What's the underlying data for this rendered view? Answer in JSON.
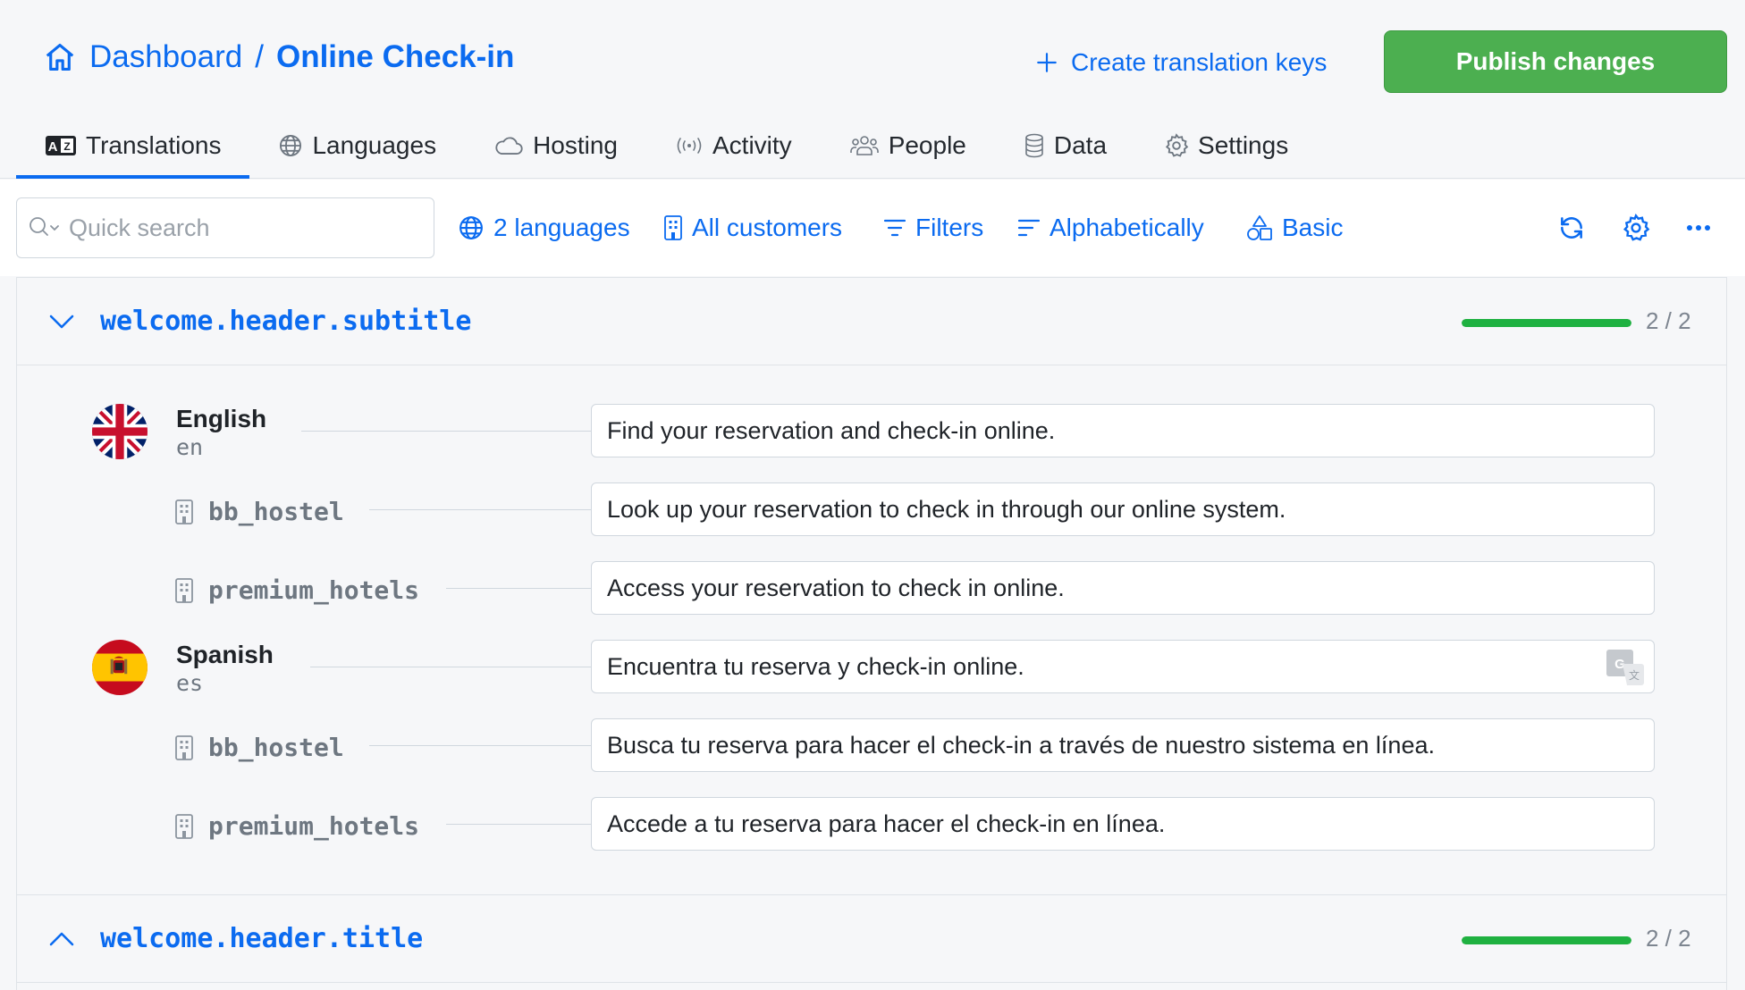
{
  "header": {
    "breadcrumb_home": "Dashboard",
    "breadcrumb_sep": "/",
    "breadcrumb_current": "Online Check-in",
    "create_keys_label": "Create translation keys",
    "publish_label": "Publish changes"
  },
  "tabs": [
    {
      "label": "Translations",
      "icon": "translate-icon",
      "active": true
    },
    {
      "label": "Languages",
      "icon": "globe-icon",
      "active": false
    },
    {
      "label": "Hosting",
      "icon": "cloud-icon",
      "active": false
    },
    {
      "label": "Activity",
      "icon": "broadcast-icon",
      "active": false
    },
    {
      "label": "People",
      "icon": "people-icon",
      "active": false
    },
    {
      "label": "Data",
      "icon": "database-icon",
      "active": false
    },
    {
      "label": "Settings",
      "icon": "gear-icon",
      "active": false
    }
  ],
  "toolbar": {
    "search_placeholder": "Quick search",
    "languages_label": "2 languages",
    "customers_label": "All customers",
    "filters_label": "Filters",
    "sort_label": "Alphabetically",
    "view_label": "Basic"
  },
  "keys": [
    {
      "name": "welcome.header.subtitle",
      "expanded": true,
      "progress_text": "2 / 2",
      "progress": 1.0,
      "languages": [
        {
          "name": "English",
          "code": "en",
          "flag": "uk-flag",
          "value": "Find your reservation and check-in online.",
          "customers": [
            {
              "name": "bb_hostel",
              "value": "Look up your reservation to check in through our online system."
            },
            {
              "name": "premium_hotels",
              "value": "Access your reservation to check in online."
            }
          ]
        },
        {
          "name": "Spanish",
          "code": "es",
          "flag": "spain-flag",
          "value": "Encuentra tu reserva y check-in online.",
          "machine_translated": true,
          "customers": [
            {
              "name": "bb_hostel",
              "value": "Busca tu reserva para hacer el check-in a través de nuestro sistema en línea."
            },
            {
              "name": "premium_hotels",
              "value": "Accede a tu reserva para hacer el check-in en línea."
            }
          ]
        }
      ]
    },
    {
      "name": "welcome.header.title",
      "expanded": false,
      "progress_text": "2 / 2",
      "progress": 1.0
    }
  ],
  "colors": {
    "accent": "#0b6bf0",
    "publish_green": "#4caf50",
    "progress_green": "#1fb141"
  }
}
